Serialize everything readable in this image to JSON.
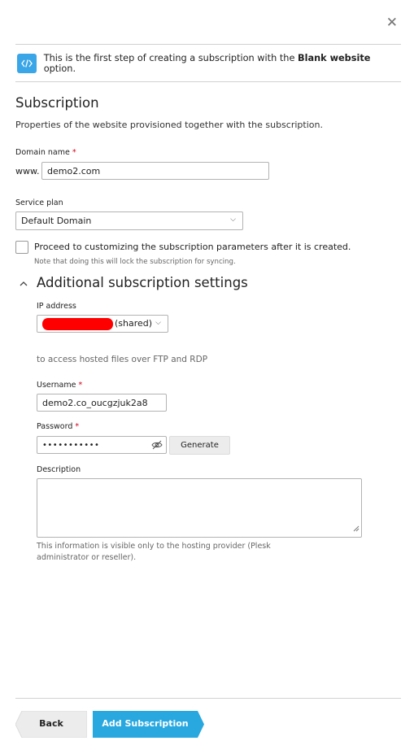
{
  "close_icon": "close-icon",
  "info": {
    "icon": "code-icon",
    "text_before": "This is the first step of creating a subscription with the ",
    "text_bold": "Blank website",
    "text_after": " option."
  },
  "subscription": {
    "title": "Subscription",
    "description": "Properties of the website provisioned together with the subscription."
  },
  "domain": {
    "label": "Domain name",
    "required_mark": "*",
    "prefix": "www.",
    "value": "demo2.com"
  },
  "service_plan": {
    "label": "Service plan",
    "selected": "Default Domain"
  },
  "customize": {
    "checked": false,
    "label": "Proceed to customizing the subscription parameters after it is created.",
    "note": "Note that doing this will lock the subscription for syncing."
  },
  "additional": {
    "title": "Additional subscription settings",
    "expanded": true,
    "ip_label": "IP address",
    "ip_suffix": "(shared)",
    "ftp_text": "to access hosted files over FTP and RDP",
    "username_label": "Username",
    "username_value": "demo2.co_oucgzjuk2a8",
    "password_label": "Password",
    "password_value": "•••••••••••",
    "generate_label": "Generate",
    "description_label": "Description",
    "description_value": "",
    "help_text": "This information is visible only to the hosting provider (Plesk administrator or reseller)."
  },
  "footer": {
    "back_label": "Back",
    "add_label": "Add Subscription"
  },
  "colors": {
    "accent": "#29a8e0",
    "required": "#d0021b",
    "redaction": "#ff0000"
  }
}
